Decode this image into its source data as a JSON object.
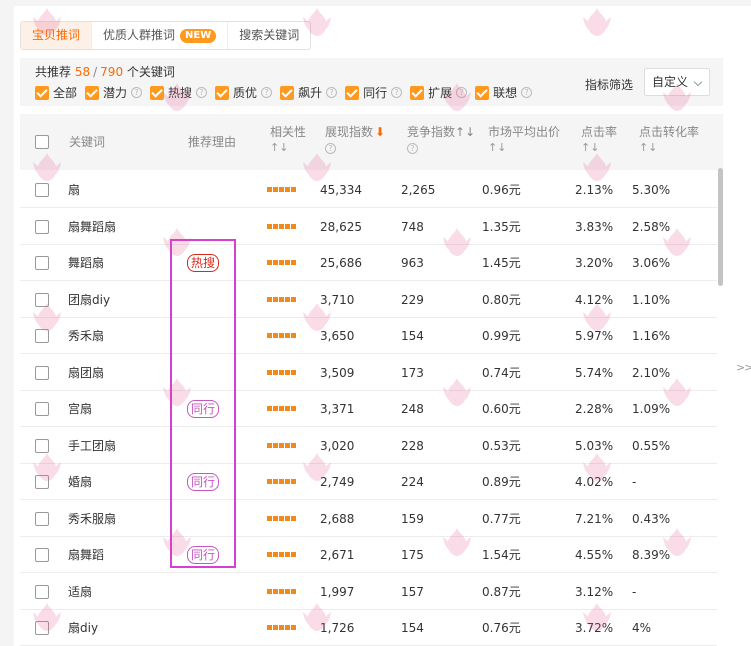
{
  "tabs": [
    {
      "label": "宝贝推词",
      "active": true
    },
    {
      "label": "优质人群推词",
      "badge": "NEW"
    },
    {
      "label": "搜索关键词"
    }
  ],
  "summary": {
    "prefix": "共推荐",
    "count": "58",
    "slash": "/",
    "total": "790",
    "suffix": "个关键词"
  },
  "filters": [
    {
      "label": "全部",
      "help": false
    },
    {
      "label": "潜力",
      "help": true
    },
    {
      "label": "热搜",
      "help": true
    },
    {
      "label": "质优",
      "help": true
    },
    {
      "label": "飙升",
      "help": true
    },
    {
      "label": "同行",
      "help": true
    },
    {
      "label": "扩展",
      "help": true
    },
    {
      "label": "联想",
      "help": true
    }
  ],
  "metric_filter": {
    "label": "指标筛选",
    "value": "自定义"
  },
  "columns": {
    "keyword": "关键词",
    "reason": "推荐理由",
    "relevance": "相关性",
    "impressions": "展现指数",
    "competition": "竞争指数",
    "avg_bid": "市场平均出价",
    "ctr": "点击率",
    "cvr": "点击转化率",
    "sort_glyph": "↑↓",
    "sort_down": "⬇"
  },
  "rows": [
    {
      "keyword": "扇",
      "reason": "",
      "impressions": "45,334",
      "competition": "2,265",
      "bid": "0.96元",
      "ctr": "2.13%",
      "cvr": "5.30%"
    },
    {
      "keyword": "扇舞蹈扇",
      "reason": "",
      "impressions": "28,625",
      "competition": "748",
      "bid": "1.35元",
      "ctr": "3.83%",
      "cvr": "2.58%"
    },
    {
      "keyword": "舞蹈扇",
      "reason": "热搜",
      "impressions": "25,686",
      "competition": "963",
      "bid": "1.45元",
      "ctr": "3.20%",
      "cvr": "3.06%"
    },
    {
      "keyword": "团扇diy",
      "reason": "",
      "impressions": "3,710",
      "competition": "229",
      "bid": "0.80元",
      "ctr": "4.12%",
      "cvr": "1.10%"
    },
    {
      "keyword": "秀禾扇",
      "reason": "",
      "impressions": "3,650",
      "competition": "154",
      "bid": "0.99元",
      "ctr": "5.97%",
      "cvr": "1.16%"
    },
    {
      "keyword": "扇团扇",
      "reason": "",
      "impressions": "3,509",
      "competition": "173",
      "bid": "0.74元",
      "ctr": "5.74%",
      "cvr": "2.10%"
    },
    {
      "keyword": "宫扇",
      "reason": "同行",
      "impressions": "3,371",
      "competition": "248",
      "bid": "0.60元",
      "ctr": "2.28%",
      "cvr": "1.09%"
    },
    {
      "keyword": "手工团扇",
      "reason": "",
      "impressions": "3,020",
      "competition": "228",
      "bid": "0.53元",
      "ctr": "5.03%",
      "cvr": "0.55%"
    },
    {
      "keyword": "婚扇",
      "reason": "同行",
      "impressions": "2,749",
      "competition": "224",
      "bid": "0.89元",
      "ctr": "4.02%",
      "cvr": "-"
    },
    {
      "keyword": "秀禾服扇",
      "reason": "",
      "impressions": "2,688",
      "competition": "159",
      "bid": "0.77元",
      "ctr": "7.21%",
      "cvr": "0.43%"
    },
    {
      "keyword": "扇舞蹈",
      "reason": "同行",
      "impressions": "2,671",
      "competition": "175",
      "bid": "1.54元",
      "ctr": "4.55%",
      "cvr": "8.39%"
    },
    {
      "keyword": "适扇",
      "reason": "",
      "impressions": "1,997",
      "competition": "157",
      "bid": "0.87元",
      "ctr": "3.12%",
      "cvr": "-"
    },
    {
      "keyword": "扇diy",
      "reason": "",
      "impressions": "1,726",
      "competition": "154",
      "bid": "0.76元",
      "ctr": "3.72%",
      "cvr": "4%"
    }
  ],
  "relevance_stars": 5,
  "expand_glyph": ">>",
  "colors": {
    "accent": "#ff6a00",
    "check": "#ff9a1f",
    "hot": "#d9281c",
    "same": "#c656c0",
    "highlight": "#d63fd1",
    "watermark": "#e5568a"
  }
}
